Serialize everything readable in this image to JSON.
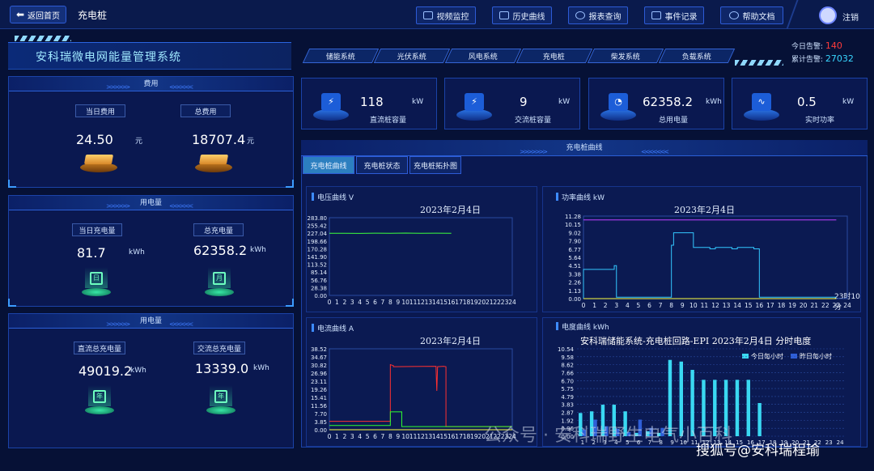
{
  "topbar": {
    "back_label": "返回首页",
    "page_label": "充电桩",
    "nav": [
      "视频监控",
      "历史曲线",
      "报表查询",
      "事件记录",
      "帮助文档"
    ],
    "logout": "注销"
  },
  "system": {
    "title": "安科瑞微电网能量管理系统",
    "tabs": [
      "储能系统",
      "光伏系统",
      "风电系统",
      "充电桩",
      "柴发系统",
      "负载系统"
    ]
  },
  "alarms": {
    "today_label": "今日告警:",
    "today_value": "140",
    "total_label": "累计告警:",
    "total_value": "27032",
    "today_color": "#ff3b3b",
    "total_color": "#38d6ff"
  },
  "fee_panel": {
    "title": "费用",
    "day_label": "当日费用",
    "day_value": "24.50",
    "day_unit": "元",
    "total_label": "总费用",
    "total_value": "18707.4",
    "total_unit": "元"
  },
  "energy_panel": {
    "title": "用电量",
    "day_label": "当日充电量",
    "day_value": "81.7",
    "day_unit": "kWh",
    "day_icon": "日",
    "total_label": "总充电量",
    "total_value": "62358.2",
    "total_unit": "kWh",
    "total_icon": "月"
  },
  "energy_panel2": {
    "title": "用电量",
    "dc_label": "直流总充电量",
    "dc_value": "49019.2",
    "dc_unit": "kWh",
    "dc_icon": "年",
    "ac_label": "交流总充电量",
    "ac_value": "13339.0",
    "ac_unit": "kWh",
    "ac_icon": "年"
  },
  "cards": [
    {
      "value": "118",
      "unit": "kW",
      "label": "直流桩容量",
      "icon": "lightning-icon"
    },
    {
      "value": "9",
      "unit": "kW",
      "label": "交流桩容量",
      "icon": "lightning-icon"
    },
    {
      "value": "62358.2",
      "unit": "kWh",
      "label": "总用电量",
      "icon": "gauge-icon"
    },
    {
      "value": "0.5",
      "unit": "kW",
      "label": "实时功率",
      "icon": "pulse-icon"
    }
  ],
  "main": {
    "title": "充电桩曲线",
    "tabs": [
      "充电桩曲线",
      "充电桩状态",
      "充电桩拓扑图"
    ]
  },
  "charts": {
    "voltage": {
      "title": "电压曲线  V",
      "date": "2023年2月4日"
    },
    "power": {
      "title": "功率曲线  kW",
      "date": "2023年2月4日",
      "annotation": "23时10分"
    },
    "current": {
      "title": "电流曲线  A",
      "date": "2023年2月4日"
    },
    "energy": {
      "title": "电度曲线  kWh",
      "heading": "安科瑞储能系统-充电桩回路-EPI 2023年2月4日 分时电度",
      "legend_today": "今日每小时",
      "legend_yesterday": "昨日每小时"
    }
  },
  "chart_data": [
    {
      "type": "line",
      "title": "电压曲线 V",
      "x": [
        0,
        2,
        4,
        6,
        8,
        10,
        12,
        14,
        16
      ],
      "series": [
        {
          "values": [
            227.04,
            227.04,
            226.5,
            227.2,
            226.8,
            227.6,
            227.0,
            227.3,
            227.04
          ]
        }
      ],
      "yticks": [
        "0.00",
        "28.38",
        "56.76",
        "85.14",
        "113.52",
        "141.90",
        "170.28",
        "198.66",
        "227.04",
        "255.42",
        "283.80"
      ],
      "xticks": [
        "0",
        "1",
        "2",
        "3",
        "4",
        "5",
        "6",
        "7",
        "8",
        "9",
        "10",
        "11",
        "12",
        "13",
        "14",
        "15",
        "16",
        "17",
        "18",
        "19",
        "20",
        "21",
        "22",
        "23",
        "24"
      ],
      "ylim": [
        0,
        283.8
      ],
      "color": "#3cff3c"
    },
    {
      "type": "line",
      "title": "功率曲线 kW",
      "xticks": [
        "0",
        "1",
        "2",
        "3",
        "4",
        "5",
        "6",
        "7",
        "8",
        "9",
        "10",
        "11",
        "12",
        "13",
        "14",
        "15",
        "16",
        "17",
        "18",
        "19",
        "20",
        "21",
        "22",
        "23",
        "24"
      ],
      "yticks": [
        "0.00",
        "1.13",
        "2.26",
        "3.38",
        "4.51",
        "5.64",
        "6.77",
        "7.90",
        "9.02",
        "10.15",
        "11.28"
      ],
      "ylim": [
        0,
        11.28
      ],
      "series": [
        {
          "x": [
            0,
            0,
            2.8,
            2.8,
            3,
            3,
            8,
            8,
            8.2,
            8.2,
            10,
            10,
            11.5,
            11.5,
            12,
            12,
            13.5,
            13.5,
            14,
            14,
            15.5,
            15.5,
            16,
            16,
            23
          ],
          "values": [
            0,
            4.0,
            4.0,
            4.5,
            4.5,
            0.2,
            0.2,
            7.3,
            7.3,
            9.0,
            9.0,
            7.0,
            7.0,
            6.8,
            6.8,
            7.0,
            7.0,
            6.8,
            6.8,
            7.0,
            7.0,
            6.8,
            6.8,
            0.2,
            0.2
          ],
          "color": "#33c7ff"
        },
        {
          "x": [
            0,
            23
          ],
          "values": [
            10.75,
            10.75
          ],
          "color": "#c040ff"
        },
        {
          "x": [
            0,
            23
          ],
          "values": [
            0,
            0
          ],
          "color": "#ffff40"
        }
      ]
    },
    {
      "type": "line",
      "title": "电流曲线 A",
      "xticks": [
        "0",
        "1",
        "2",
        "3",
        "4",
        "5",
        "6",
        "7",
        "8",
        "9",
        "10",
        "11",
        "12",
        "13",
        "14",
        "15",
        "16",
        "17",
        "18",
        "19",
        "20",
        "21",
        "22",
        "23",
        "24"
      ],
      "yticks": [
        "0.00",
        "3.85",
        "7.70",
        "11.56",
        "15.41",
        "19.26",
        "23.11",
        "26.96",
        "30.82",
        "34.67",
        "38.52"
      ],
      "ylim": [
        0,
        38.52
      ],
      "series": [
        {
          "x": [
            0,
            8,
            8,
            8.4,
            8.4,
            14,
            14,
            14.1,
            14.2,
            15,
            15.3,
            15.3,
            24
          ],
          "values": [
            4.0,
            4.0,
            31.0,
            30.5,
            30.0,
            30.2,
            29.0,
            18.5,
            30.0,
            30.2,
            30.0,
            1.5,
            1.5
          ],
          "color": "#ff3030"
        },
        {
          "x": [
            0,
            8,
            8,
            9.5,
            9.5,
            24
          ],
          "values": [
            2.0,
            2.0,
            8.5,
            8.5,
            1.5,
            1.5
          ],
          "color": "#30ff30"
        },
        {
          "x": [
            0,
            24
          ],
          "values": [
            0.0,
            0.0
          ],
          "color": "#ffff40"
        }
      ]
    },
    {
      "type": "bar",
      "title": "安科瑞储能系统-充电桩回路-EPI 2023年2月4日 分时电度",
      "categories": [
        "1",
        "2",
        "3",
        "4",
        "5",
        "6",
        "7",
        "8",
        "9",
        "10",
        "11",
        "12",
        "13",
        "14",
        "15",
        "16",
        "17",
        "18",
        "19",
        "20",
        "21",
        "22",
        "23",
        "24"
      ],
      "yticks": [
        "0.00",
        "0.96",
        "1.92",
        "2.87",
        "3.83",
        "4.79",
        "5.75",
        "6.70",
        "7.66",
        "8.62",
        "9.58",
        "10.54"
      ],
      "ylim": [
        0,
        10.54
      ],
      "series": [
        {
          "name": "今日每小时",
          "values": [
            2.8,
            3.0,
            3.8,
            3.8,
            3.0,
            0.4,
            0.6,
            0.4,
            9.2,
            9.0,
            8.0,
            6.8,
            6.8,
            6.8,
            6.8,
            6.8,
            4.0,
            0,
            0,
            0,
            0,
            0,
            0,
            0
          ],
          "color": "#3ad8f2"
        },
        {
          "name": "昨日每小时",
          "values": [
            0.8,
            2.0,
            1.2,
            0.9,
            0.5,
            2.0,
            1.0,
            1.0,
            0,
            0,
            0,
            0,
            0,
            0,
            0,
            0,
            0,
            0,
            0,
            0,
            0,
            0,
            0,
            0
          ],
          "color": "#2f5fd8"
        }
      ]
    }
  ],
  "overlay": {
    "watermark": "公众号 · 安科瑞野生电气小百科",
    "sohu": "搜狐号@安科瑞程瑜"
  }
}
